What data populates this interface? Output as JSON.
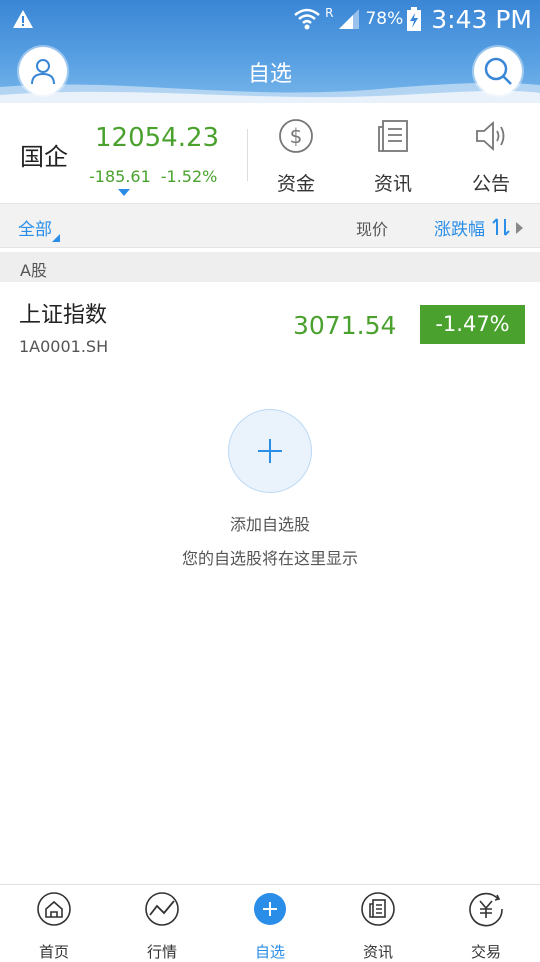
{
  "status_bar": {
    "battery": "78%",
    "roaming": "R",
    "time": "3:43 PM"
  },
  "header": {
    "title": "自选"
  },
  "index_summary": {
    "name": "国企",
    "value": "12054.23",
    "change": "-185.61",
    "change_pct": "-1.52%"
  },
  "quick_links": [
    {
      "label": "资金",
      "icon": "dollar-circle-icon"
    },
    {
      "label": "资讯",
      "icon": "news-icon"
    },
    {
      "label": "公告",
      "icon": "speaker-icon"
    }
  ],
  "columns": {
    "all": "全部",
    "price": "现价",
    "change": "涨跌幅"
  },
  "section": {
    "title": "A股"
  },
  "stocks": [
    {
      "name": "上证指数",
      "code": "1A0001.SH",
      "price": "3071.54",
      "change_pct": "-1.47%"
    }
  ],
  "empty_state": {
    "title": "添加自选股",
    "subtitle": "您的自选股将在这里显示"
  },
  "bottom_nav": [
    {
      "label": "首页",
      "icon": "home-icon"
    },
    {
      "label": "行情",
      "icon": "chart-icon"
    },
    {
      "label": "自选",
      "icon": "plus-icon"
    },
    {
      "label": "资讯",
      "icon": "news-icon"
    },
    {
      "label": "交易",
      "icon": "yen-icon"
    }
  ],
  "colors": {
    "accent": "#2a8ee8",
    "down": "#4aa12e"
  }
}
